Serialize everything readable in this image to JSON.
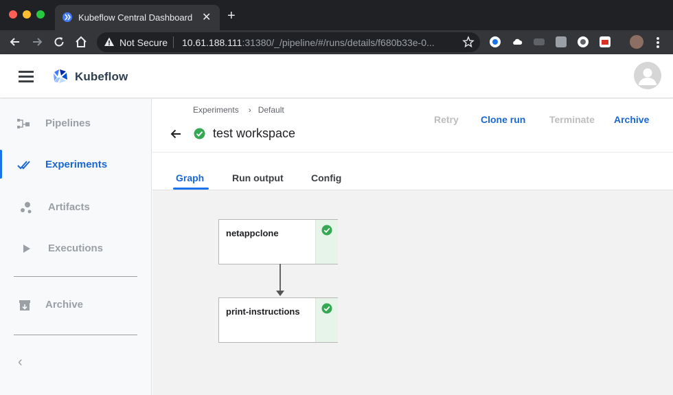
{
  "browser": {
    "tab_title": "Kubeflow Central Dashboard",
    "close_glyph": "✕",
    "newtab_glyph": "+",
    "security_label": "Not Secure",
    "url_host": "10.61.188.111",
    "url_rest": ":31380/_/pipeline/#/runs/details/f680b33e-0..."
  },
  "app": {
    "brand": "Kubeflow"
  },
  "sidebar": {
    "items": [
      {
        "label": "Pipelines",
        "icon": "pipelines-icon"
      },
      {
        "label": "Experiments",
        "icon": "experiments-icon"
      },
      {
        "label": "Artifacts",
        "icon": "artifacts-icon"
      },
      {
        "label": "Executions",
        "icon": "executions-icon"
      },
      {
        "label": "Archive",
        "icon": "archive-icon"
      }
    ],
    "active": "Experiments",
    "collapse_glyph": "‹"
  },
  "run": {
    "breadcrumb": [
      "Experiments",
      "Default"
    ],
    "breadcrumb_sep": "›",
    "title": "test workspace",
    "status": "succeeded",
    "actions": {
      "retry": "Retry",
      "clone": "Clone run",
      "terminate": "Terminate",
      "archive": "Archive"
    }
  },
  "tabs": [
    "Graph",
    "Run output",
    "Config"
  ],
  "active_tab": "Graph",
  "graph": {
    "nodes": [
      {
        "name": "netappclone",
        "status": "succeeded"
      },
      {
        "name": "print-instructions",
        "status": "succeeded"
      }
    ]
  },
  "colors": {
    "accent": "#1967d2",
    "success": "#34a853",
    "nav_inactive": "#9aa0a6"
  }
}
